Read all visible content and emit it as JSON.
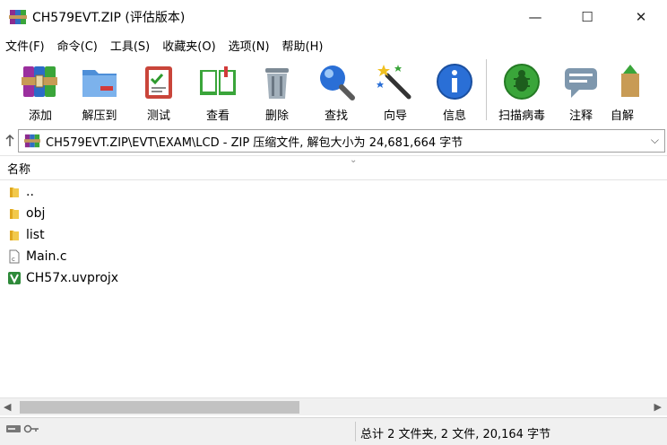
{
  "window": {
    "title": "CH579EVT.ZIP (评估版本)",
    "minimize": "—",
    "maximize": "☐",
    "close": "✕"
  },
  "menu": [
    "文件(F)",
    "命令(C)",
    "工具(S)",
    "收藏夹(O)",
    "选项(N)",
    "帮助(H)"
  ],
  "toolbar": {
    "add": "添加",
    "extract": "解压到",
    "test": "测试",
    "view": "查看",
    "delete": "删除",
    "find": "查找",
    "wizard": "向导",
    "info": "信息",
    "scan": "扫描病毒",
    "comment": "注释",
    "sfx": "自解"
  },
  "address": {
    "path": "CH579EVT.ZIP\\EVT\\EXAM\\LCD - ZIP 压缩文件, 解包大小为 24,681,664 字节"
  },
  "list": {
    "column_name": "名称",
    "files": [
      {
        "name": "..",
        "icon": "folder-icon"
      },
      {
        "name": "obj",
        "icon": "folder-icon"
      },
      {
        "name": "list",
        "icon": "folder-icon"
      },
      {
        "name": "Main.c",
        "icon": "c-file-icon"
      },
      {
        "name": "CH57x.uvprojx",
        "icon": "keil-project-icon"
      }
    ]
  },
  "status": {
    "summary": "总计 2 文件夹, 2 文件, 20,164 字节"
  },
  "colors": {
    "folder": "#f2c94c",
    "accent_green": "#3aa53a",
    "info_blue": "#2a6fd6",
    "scrollbar_thumb": "#c2c2c2"
  }
}
